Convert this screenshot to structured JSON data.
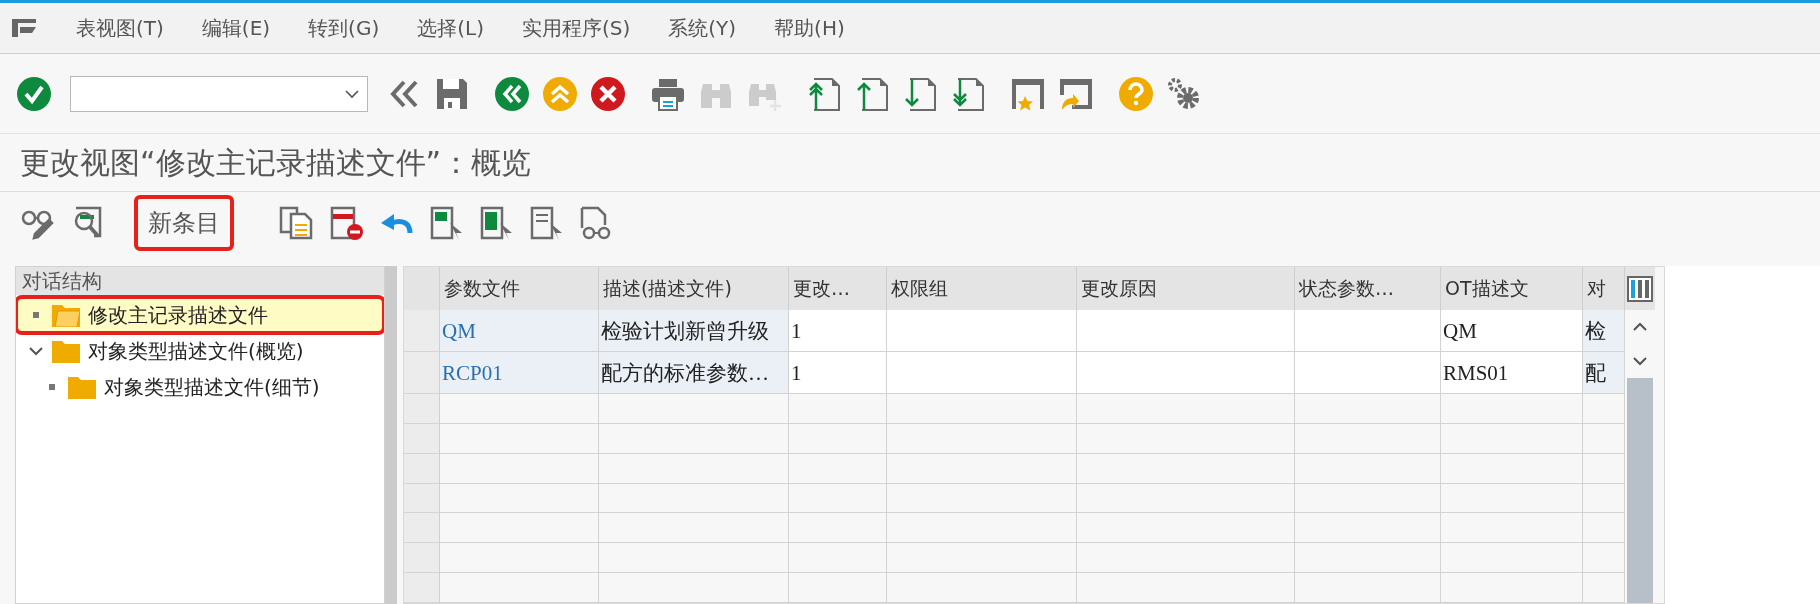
{
  "menu": [
    "表视图(T)",
    "编辑(E)",
    "转到(G)",
    "选择(L)",
    "实用程序(S)",
    "系统(Y)",
    "帮助(H)"
  ],
  "toolbar": [
    {
      "kind": "check",
      "disabled": false
    },
    {
      "kind": "command_field"
    },
    {
      "kind": "back_double",
      "disabled": false
    },
    {
      "kind": "save",
      "disabled": false
    },
    {
      "kind": "back",
      "disabled": false
    },
    {
      "kind": "exit",
      "disabled": false
    },
    {
      "kind": "cancel",
      "disabled": false
    },
    {
      "kind": "print",
      "disabled": false
    },
    {
      "kind": "find",
      "disabled": true
    },
    {
      "kind": "find_next",
      "disabled": true
    },
    {
      "kind": "first_page",
      "disabled": false
    },
    {
      "kind": "prev_page",
      "disabled": false
    },
    {
      "kind": "next_page",
      "disabled": false
    },
    {
      "kind": "last_page",
      "disabled": false
    },
    {
      "kind": "new_session",
      "disabled": false
    },
    {
      "kind": "shortcut",
      "disabled": false
    },
    {
      "kind": "help",
      "disabled": false
    },
    {
      "kind": "settings",
      "disabled": false
    }
  ],
  "title": "更改视图“修改主记录描述文件”：概览",
  "app_toolbar": [
    {
      "kind": "display_change"
    },
    {
      "kind": "where_used"
    },
    {
      "kind": "text",
      "label": "新条目",
      "highlighted": true
    },
    {
      "kind": "copy"
    },
    {
      "kind": "delete"
    },
    {
      "kind": "undo"
    },
    {
      "kind": "select_all"
    },
    {
      "kind": "select_block"
    },
    {
      "kind": "deselect_all"
    },
    {
      "kind": "other_view"
    }
  ],
  "tree": {
    "title": "对话结构",
    "items": [
      {
        "label": "修改主记录描述文件",
        "selected": true,
        "highlighted": true
      },
      {
        "label": "对象类型描述文件(概览)",
        "selected": false,
        "highlighted": false,
        "expanded": true,
        "children": [
          {
            "label": "对象类型描述文件(细节)",
            "selected": false,
            "highlighted": false
          }
        ]
      }
    ]
  },
  "table": {
    "columns": [
      "参数文件",
      "描述(描述文件)",
      "更改…",
      "权限组",
      "更改原因",
      "状态参数…",
      "OT描述文",
      "对"
    ],
    "rows": [
      [
        "QM",
        "检验计划新曾升级",
        "1",
        "",
        "",
        "",
        "QM",
        "检"
      ],
      [
        "RCP01",
        "配方的标准参数…",
        "1",
        "",
        "",
        "",
        "RMS01",
        "配"
      ]
    ]
  }
}
